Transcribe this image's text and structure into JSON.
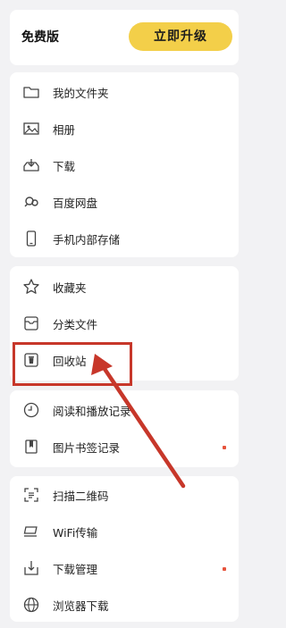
{
  "header": {
    "plan_label": "免费版",
    "upgrade_label": "立即升级"
  },
  "groups": [
    {
      "items": [
        {
          "icon": "folder-icon",
          "label": "我的文件夹"
        },
        {
          "icon": "album-icon",
          "label": "相册"
        },
        {
          "icon": "download-tray-icon",
          "label": "下载"
        },
        {
          "icon": "baidu-netdisk-icon",
          "label": "百度网盘"
        },
        {
          "icon": "phone-storage-icon",
          "label": "手机内部存储"
        }
      ]
    },
    {
      "items": [
        {
          "icon": "star-icon",
          "label": "收藏夹"
        },
        {
          "icon": "archive-icon",
          "label": "分类文件"
        },
        {
          "icon": "trash-icon",
          "label": "回收站"
        }
      ]
    },
    {
      "items": [
        {
          "icon": "clock-icon",
          "label": "阅读和播放记录"
        },
        {
          "icon": "bookmark-icon",
          "label": "图片书签记录"
        }
      ]
    },
    {
      "items": [
        {
          "icon": "scan-icon",
          "label": "扫描二维码"
        },
        {
          "icon": "wifi-transfer-icon",
          "label": "WiFi传输"
        },
        {
          "icon": "download-manager-icon",
          "label": "下载管理"
        },
        {
          "icon": "globe-icon",
          "label": "浏览器下载"
        }
      ]
    }
  ],
  "annotation_color": "#c7372a",
  "badge_color": "#e6533c",
  "accent_color": "#f3cf49"
}
